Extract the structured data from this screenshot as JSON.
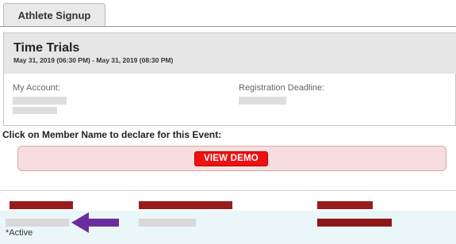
{
  "tabs": [
    {
      "label": "Athlete Signup"
    }
  ],
  "event": {
    "title": "Time Trials",
    "dates": "May 31, 2019 (06:30 PM) - May 31, 2019 (08:30 PM)",
    "my_account_label": "My Account:",
    "registration_deadline_label": "Registration Deadline:"
  },
  "instruction": "Click on Member Name to declare for this Event:",
  "demo_button": {
    "label": "VIEW DEMO"
  },
  "members": {
    "active_note": "*Active"
  },
  "colors": {
    "accent_red": "#ee1111",
    "header_bar": "#971d1d",
    "highlight_arrow": "#6b2d9e"
  }
}
